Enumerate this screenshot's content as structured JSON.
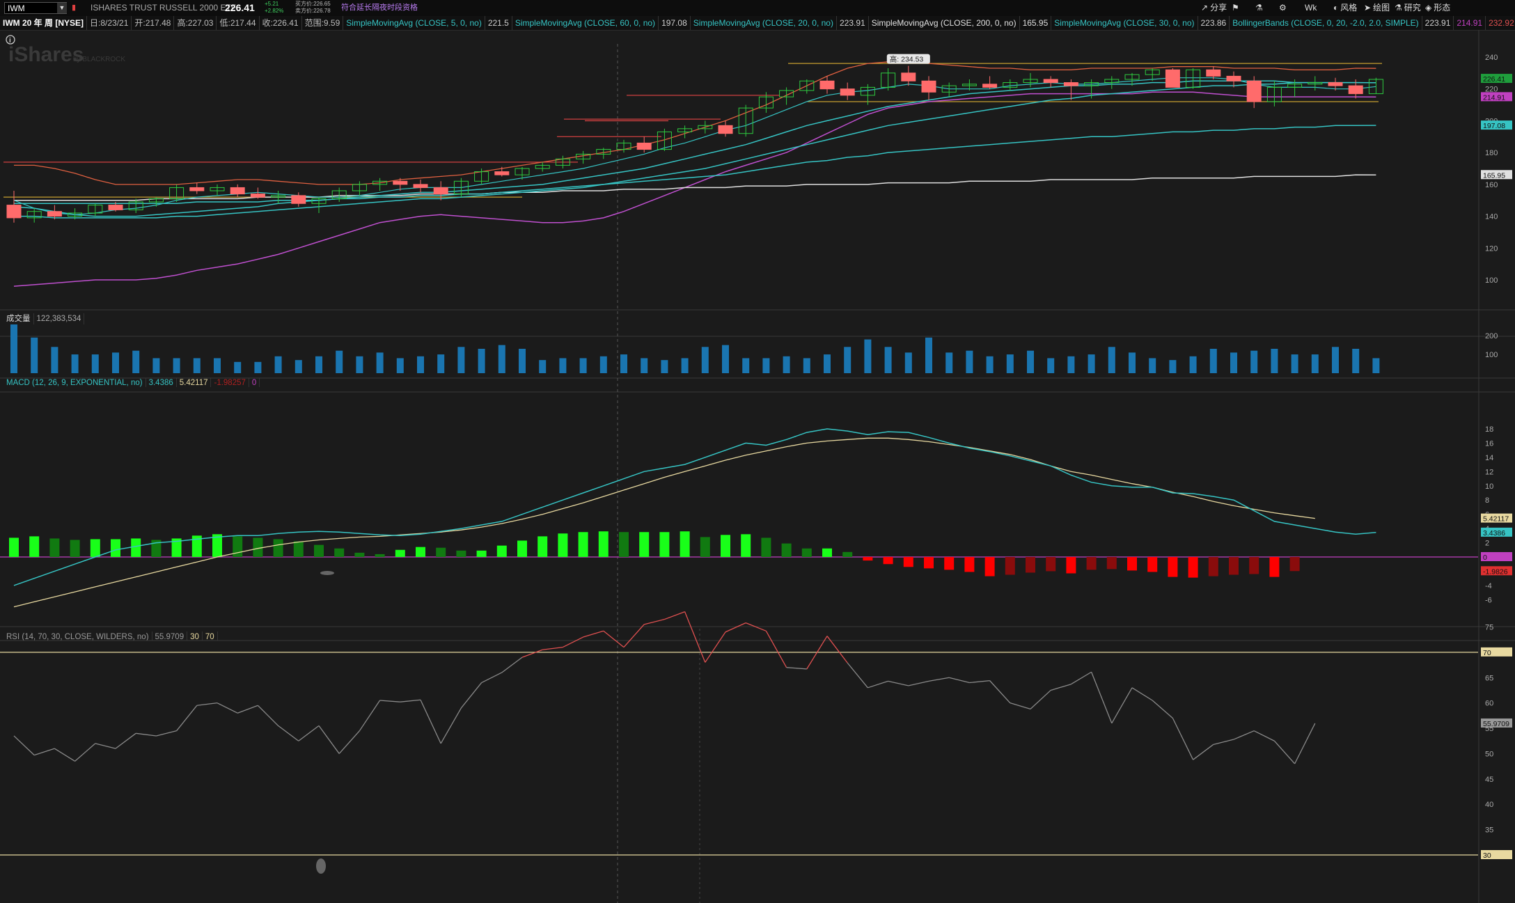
{
  "toolbar": {
    "symbol": "IWM",
    "company": "ISHARES TRUST RUSSELL 2000 ETF",
    "last": "226.41",
    "change": "+5.21",
    "change_pct": "+2.82%",
    "bid": "买方价:226.65",
    "ask": "卖方价:226.78",
    "extended_note": "符合延长隔夜时段资格",
    "right_buttons": [
      {
        "icon": "share-icon",
        "label": "分享"
      },
      {
        "icon": "flag-icon",
        "label": ""
      },
      {
        "icon": "beaker-icon",
        "label": ""
      },
      {
        "icon": "gear-icon",
        "label": ""
      },
      {
        "icon": "timeframe-icon",
        "label": "Wk"
      },
      {
        "icon": "style-icon",
        "label": "风格"
      },
      {
        "icon": "cursor-icon",
        "label": "绘图"
      },
      {
        "icon": "flask-icon",
        "label": "研究"
      },
      {
        "icon": "pattern-icon",
        "label": "形态"
      }
    ]
  },
  "infobar": {
    "title": "IWM 20 年 周 [NYSE]",
    "date": "日:8/23/21",
    "open": "开:217.48",
    "high": "高:227.03",
    "low": "低:217.44",
    "close": "收:226.41",
    "range": "范围:9.59",
    "studies": [
      {
        "name": "SimpleMovingAvg (CLOSE, 5, 0, no)",
        "value": "221.5",
        "color": "#36c4c4"
      },
      {
        "name": "SimpleMovingAvg (CLOSE, 60, 0, no)",
        "value": "197.08",
        "color": "#36c4c4"
      },
      {
        "name": "SimpleMovingAvg (CLOSE, 20, 0, no)",
        "value": "223.91",
        "color": "#36c4c4"
      },
      {
        "name": "SimpleMovingAvg (CLOSE, 200, 0, no)",
        "value": "165.95",
        "color": "#e0e0e0"
      },
      {
        "name": "SimpleMovingAvg (CLOSE, 30, 0, no)",
        "value": "223.86",
        "color": "#36c4c4"
      },
      {
        "name": "BollingerBands (CLOSE, 0, 20, -2.0, 2.0, SIMPLE)",
        "value": "223.91",
        "color": "#36c4c4"
      }
    ],
    "bb_lower": "214.91",
    "bb_upper": "232.92"
  },
  "price_pane": {
    "watermark": "iShares",
    "watermark_sub": "by BLACKROCK",
    "high_label": "高: 234.53",
    "y_ticks": [
      "240",
      "220",
      "200",
      "180",
      "160",
      "140",
      "120",
      "100"
    ],
    "badges": [
      {
        "text": "226.41",
        "color": "#1f9e3c"
      },
      {
        "text": "214.91",
        "color": "#c040c0"
      },
      {
        "text": "197.08",
        "color": "#36c4c4"
      },
      {
        "text": "165.95",
        "color": "#e0e0e0"
      }
    ]
  },
  "volume_pane": {
    "title": "成交量",
    "value": "122,383,534",
    "y_ticks": [
      "200",
      "100"
    ]
  },
  "macd_pane": {
    "title": "MACD (12, 26, 9, EXPONENTIAL, no)",
    "value": "3.4386",
    "avg": "5.42117",
    "diff": "-1.98257",
    "zero": "0",
    "y_ticks": [
      "18",
      "16",
      "14",
      "12",
      "10",
      "8",
      "6",
      "4",
      "2",
      "-2",
      "-4",
      "-6"
    ],
    "badges": [
      {
        "text": "5.42117",
        "color": "#e8d9a0"
      },
      {
        "text": "3.4386",
        "color": "#36c4c4"
      },
      {
        "text": "0",
        "color": "#c040c0"
      },
      {
        "text": "-1.9826",
        "color": "#e03030"
      }
    ]
  },
  "rsi_pane": {
    "title": "RSI (14, 70, 30, CLOSE, WILDERS, no)",
    "value": "55.9709",
    "ob": "30",
    "os": "70",
    "y_ticks": [
      "75",
      "70",
      "65",
      "60",
      "55",
      "50",
      "45",
      "40",
      "35",
      "30"
    ],
    "badges": [
      {
        "text": "70",
        "color": "#e8d9a0"
      },
      {
        "text": "55.9709",
        "color": "#999"
      },
      {
        "text": "30",
        "color": "#e8d9a0"
      }
    ]
  },
  "series": {
    "candles": [
      [
        147,
        156,
        136,
        139
      ],
      [
        139,
        145,
        136,
        143
      ],
      [
        143,
        147,
        138,
        140
      ],
      [
        140,
        145,
        138,
        142
      ],
      [
        142,
        148,
        140,
        147
      ],
      [
        147,
        149,
        143,
        144
      ],
      [
        144,
        151,
        142,
        149
      ],
      [
        149,
        152,
        146,
        151
      ],
      [
        151,
        160,
        149,
        158
      ],
      [
        158,
        161,
        154,
        156
      ],
      [
        156,
        160,
        153,
        158
      ],
      [
        158,
        160,
        152,
        154
      ],
      [
        154,
        158,
        151,
        152
      ],
      [
        152,
        156,
        148,
        153
      ],
      [
        153,
        155,
        146,
        148
      ],
      [
        148,
        152,
        142,
        151
      ],
      [
        151,
        158,
        149,
        156
      ],
      [
        156,
        162,
        153,
        160
      ],
      [
        160,
        164,
        156,
        162
      ],
      [
        162,
        164,
        156,
        160
      ],
      [
        160,
        163,
        155,
        158
      ],
      [
        158,
        162,
        150,
        154
      ],
      [
        154,
        164,
        152,
        162
      ],
      [
        162,
        170,
        160,
        168
      ],
      [
        168,
        171,
        165,
        166
      ],
      [
        166,
        171,
        163,
        170
      ],
      [
        170,
        174,
        168,
        172
      ],
      [
        172,
        178,
        170,
        176
      ],
      [
        176,
        181,
        173,
        179
      ],
      [
        179,
        183,
        176,
        182
      ],
      [
        182,
        188,
        180,
        186
      ],
      [
        186,
        190,
        180,
        182
      ],
      [
        182,
        195,
        181,
        193
      ],
      [
        193,
        197,
        189,
        195
      ],
      [
        195,
        200,
        192,
        197
      ],
      [
        197,
        200,
        190,
        192
      ],
      [
        192,
        210,
        190,
        208
      ],
      [
        208,
        218,
        205,
        215
      ],
      [
        215,
        221,
        210,
        219
      ],
      [
        219,
        226,
        217,
        225
      ],
      [
        225,
        228,
        217,
        220
      ],
      [
        220,
        224,
        213,
        216
      ],
      [
        216,
        223,
        210,
        221
      ],
      [
        221,
        233,
        219,
        230
      ],
      [
        230,
        234.5,
        222,
        225
      ],
      [
        225,
        228,
        213,
        218
      ],
      [
        218,
        224,
        215,
        222
      ],
      [
        222,
        226,
        219,
        223
      ],
      [
        223,
        228,
        220,
        221
      ],
      [
        221,
        226,
        219,
        224
      ],
      [
        224,
        230,
        221,
        226
      ],
      [
        226,
        228,
        221,
        224
      ],
      [
        224,
        226,
        213,
        222
      ],
      [
        222,
        226,
        214,
        224
      ],
      [
        224,
        228,
        220,
        226
      ],
      [
        226,
        230,
        222,
        229
      ],
      [
        229,
        233,
        225,
        232
      ],
      [
        232,
        233,
        224,
        221
      ],
      [
        221,
        233,
        220,
        232
      ],
      [
        232,
        234,
        226,
        228
      ],
      [
        228,
        231,
        221,
        225
      ],
      [
        225,
        228,
        208,
        212
      ],
      [
        212,
        225,
        209,
        221
      ],
      [
        221,
        226,
        215,
        223
      ],
      [
        223,
        228,
        219,
        224
      ],
      [
        224,
        227,
        219,
        222
      ],
      [
        222,
        226,
        214,
        217
      ],
      [
        217,
        227,
        217,
        226
      ]
    ],
    "sma5": [
      150,
      145,
      142,
      141,
      142,
      144,
      145,
      147,
      150,
      152,
      153,
      154,
      155,
      154,
      153,
      152,
      152,
      153,
      155,
      157,
      158,
      158,
      158,
      160,
      162,
      164,
      166,
      168,
      170,
      173,
      176,
      179,
      183,
      186,
      190,
      194,
      197,
      202,
      207,
      212,
      216,
      218,
      219,
      221,
      223,
      222,
      220,
      220,
      220,
      222,
      223,
      224,
      223,
      223,
      224,
      225,
      226,
      227,
      227,
      227,
      226,
      223,
      221,
      221,
      221,
      220,
      220,
      221.5
    ],
    "sma20": [
      146,
      145,
      143,
      141,
      140,
      140,
      140,
      141,
      142,
      143,
      144,
      145,
      146,
      148,
      149,
      150,
      151,
      152,
      153,
      154,
      155,
      155,
      156,
      157,
      158,
      159,
      160,
      162,
      164,
      166,
      168,
      170,
      173,
      176,
      179,
      182,
      185,
      189,
      193,
      197,
      200,
      203,
      206,
      209,
      211,
      213,
      215,
      217,
      218,
      219,
      220,
      221,
      222,
      222,
      223,
      223,
      224,
      224,
      225,
      225,
      225,
      225,
      225,
      224,
      224,
      224,
      224,
      223.91
    ],
    "sma30": [
      140,
      140,
      139,
      139,
      139,
      139,
      139,
      139,
      140,
      140,
      141,
      142,
      143,
      144,
      145,
      146,
      147,
      148,
      149,
      150,
      151,
      151,
      152,
      153,
      154,
      155,
      156,
      157,
      158,
      160,
      162,
      164,
      166,
      168,
      170,
      173,
      176,
      179,
      182,
      185,
      188,
      191,
      194,
      197,
      199,
      201,
      203,
      205,
      207,
      209,
      211,
      213,
      214,
      216,
      217,
      218,
      219,
      220,
      221,
      222,
      222,
      223,
      223,
      224,
      224,
      224,
      224,
      223.86
    ],
    "sma60": [
      148,
      148,
      148,
      148,
      148,
      148,
      148,
      148,
      148,
      149,
      149,
      149,
      149,
      150,
      150,
      150,
      151,
      151,
      152,
      152,
      153,
      153,
      154,
      154,
      155,
      156,
      157,
      158,
      159,
      160,
      161,
      162,
      163,
      164,
      165,
      166,
      168,
      170,
      172,
      174,
      175,
      177,
      178,
      180,
      181,
      182,
      183,
      184,
      185,
      186,
      187,
      188,
      189,
      190,
      190,
      191,
      192,
      193,
      193,
      194,
      194,
      195,
      195,
      196,
      196,
      197,
      197,
      197.08
    ],
    "sma200": [
      150,
      150,
      150,
      150,
      150,
      150,
      150,
      151,
      151,
      151,
      151,
      151,
      152,
      152,
      152,
      152,
      153,
      153,
      153,
      153,
      154,
      154,
      154,
      154,
      155,
      155,
      155,
      156,
      156,
      156,
      157,
      157,
      157,
      158,
      158,
      158,
      159,
      159,
      159,
      160,
      160,
      160,
      160,
      161,
      161,
      161,
      161,
      162,
      162,
      162,
      162,
      163,
      163,
      163,
      163,
      163,
      164,
      164,
      164,
      164,
      164,
      165,
      165,
      165,
      165,
      165,
      166,
      165.95
    ],
    "bb_upper": [
      172,
      172,
      170,
      167,
      163,
      160,
      160,
      160,
      160,
      161,
      162,
      163,
      163,
      162,
      161,
      160,
      160,
      160,
      161,
      163,
      164,
      165,
      166,
      168,
      170,
      172,
      174,
      176,
      178,
      180,
      182,
      185,
      188,
      192,
      196,
      200,
      205,
      210,
      216,
      222,
      228,
      233,
      236,
      237,
      238,
      236,
      235,
      234,
      233,
      233,
      232,
      232,
      232,
      233,
      233,
      233,
      233,
      234,
      234,
      234,
      233,
      233,
      233,
      232,
      232,
      232,
      233,
      232.92
    ],
    "bb_lower": [
      96,
      97,
      98,
      99,
      100,
      100,
      100,
      101,
      103,
      106,
      108,
      110,
      113,
      116,
      120,
      124,
      128,
      132,
      136,
      138,
      140,
      141,
      140,
      139,
      138,
      137,
      136,
      136,
      137,
      139,
      143,
      148,
      153,
      158,
      163,
      168,
      172,
      176,
      180,
      186,
      192,
      198,
      204,
      208,
      210,
      212,
      213,
      214,
      215,
      216,
      217,
      217,
      217,
      217,
      217,
      217,
      218,
      218,
      218,
      217,
      216,
      215,
      215,
      215,
      215,
      215,
      215,
      214.91
    ],
    "volume": [
      260,
      190,
      140,
      100,
      100,
      110,
      120,
      80,
      80,
      80,
      80,
      60,
      60,
      90,
      70,
      90,
      120,
      90,
      110,
      80,
      90,
      100,
      140,
      130,
      150,
      130,
      70,
      80,
      80,
      90,
      100,
      80,
      70,
      80,
      140,
      150,
      80,
      80,
      90,
      80,
      100,
      140,
      180,
      140,
      110,
      190,
      110,
      120,
      90,
      100,
      120,
      80,
      90,
      100,
      140,
      110,
      80,
      70,
      90,
      130,
      110,
      120,
      130,
      100,
      100,
      140,
      130,
      80,
      70,
      110,
      130,
      90,
      140,
      120
    ],
    "macd": [
      -4,
      -3,
      -2,
      -1,
      0,
      1,
      1.5,
      2,
      2.2,
      2.5,
      2.8,
      3,
      3,
      3.3,
      3.5,
      3.6,
      3.5,
      3.3,
      3.1,
      3,
      3.2,
      3.6,
      4,
      4.5,
      5,
      6,
      7,
      8,
      9,
      10,
      11,
      12,
      12.5,
      13,
      14,
      15,
      16,
      15.7,
      16.5,
      17.5,
      18,
      17.7,
      17.2,
      17.6,
      17.5,
      16.8,
      16,
      15.3,
      14.8,
      14.2,
      13.5,
      12.8,
      11.5,
      10.5,
      10,
      9.8,
      9.8,
      9,
      8.9,
      8.5,
      8,
      6.5,
      5,
      4.5,
      4,
      3.5,
      3.2,
      3.4386
    ],
    "signal": [
      -7,
      -6.3,
      -5.6,
      -4.9,
      -4.2,
      -3.5,
      -2.8,
      -2.1,
      -1.4,
      -0.7,
      0,
      0.6,
      1.2,
      1.7,
      2.1,
      2.4,
      2.6,
      2.8,
      2.9,
      3.1,
      3.3,
      3.5,
      3.8,
      4.2,
      4.7,
      5.3,
      6,
      6.8,
      7.6,
      8.5,
      9.4,
      10.3,
      11.2,
      12,
      12.8,
      13.6,
      14.3,
      14.9,
      15.5,
      16,
      16.3,
      16.5,
      16.7,
      16.7,
      16.5,
      16.2,
      15.8,
      15.4,
      14.9,
      14.4,
      13.7,
      12.8,
      12,
      11.5,
      10.9,
      10.3,
      9.8,
      9.1,
      8.5,
      7.8,
      7.2,
      6.7,
      6.2,
      5.8,
      5.42117
    ],
    "hist": [
      2.7,
      2.9,
      2.6,
      2.4,
      2.5,
      2.5,
      2.6,
      2.4,
      2.6,
      3,
      3.2,
      2.9,
      2.7,
      2.5,
      2.2,
      1.7,
      1.2,
      0.6,
      0.4,
      1,
      1.4,
      1.3,
      0.9,
      0.9,
      1.6,
      2.3,
      2.9,
      3.3,
      3.5,
      3.6,
      3.5,
      3.5,
      3.5,
      3.6,
      2.8,
      3.1,
      3.2,
      2.7,
      1.9,
      1.2,
      1.2,
      0.7,
      -0.5,
      -1,
      -1.4,
      -1.6,
      -1.8,
      -2.1,
      -2.7,
      -2.5,
      -2.2,
      -2.0,
      -2.3,
      -1.8,
      -1.7,
      -1.9,
      -2.1,
      -2.8,
      -2.9,
      -2.7,
      -2.5,
      -2.4,
      -2.8,
      -1.98257
    ],
    "rsi": [
      53.5,
      49.7,
      51,
      48.5,
      52,
      51,
      54,
      53.5,
      54.5,
      59.5,
      60,
      58,
      59.5,
      55.5,
      52.5,
      55.5,
      50,
      54.5,
      60.5,
      60.2,
      60.6,
      52,
      59,
      64,
      66,
      69,
      70.5,
      71,
      73,
      74.2,
      71,
      75.5,
      76.5,
      78,
      68,
      74,
      75.8,
      74.2,
      67,
      66.7,
      73.2,
      67.9,
      63,
      64.3,
      63.4,
      64.3,
      65,
      64,
      64.4,
      60,
      58.8,
      62.5,
      63.7,
      66.1,
      56,
      63,
      60.5,
      57,
      48.8,
      51.8,
      52.8,
      54.5,
      52.5,
      48,
      55.9709
    ]
  }
}
